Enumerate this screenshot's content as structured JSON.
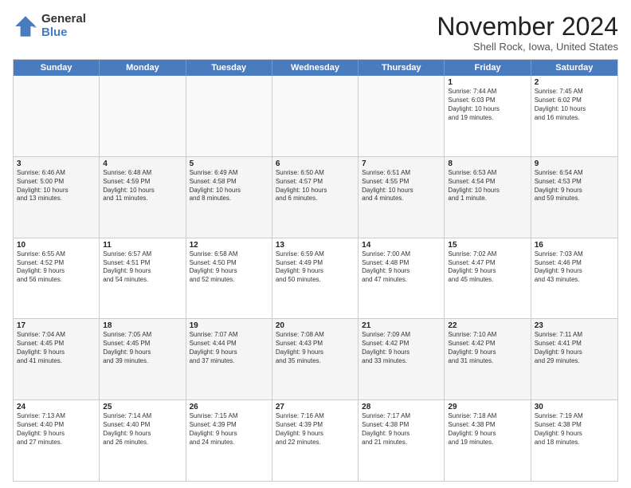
{
  "logo": {
    "general": "General",
    "blue": "Blue"
  },
  "header": {
    "month": "November 2024",
    "location": "Shell Rock, Iowa, United States"
  },
  "weekdays": [
    "Sunday",
    "Monday",
    "Tuesday",
    "Wednesday",
    "Thursday",
    "Friday",
    "Saturday"
  ],
  "rows": [
    [
      {
        "day": "",
        "text": ""
      },
      {
        "day": "",
        "text": ""
      },
      {
        "day": "",
        "text": ""
      },
      {
        "day": "",
        "text": ""
      },
      {
        "day": "",
        "text": ""
      },
      {
        "day": "1",
        "text": "Sunrise: 7:44 AM\nSunset: 6:03 PM\nDaylight: 10 hours\nand 19 minutes."
      },
      {
        "day": "2",
        "text": "Sunrise: 7:45 AM\nSunset: 6:02 PM\nDaylight: 10 hours\nand 16 minutes."
      }
    ],
    [
      {
        "day": "3",
        "text": "Sunrise: 6:46 AM\nSunset: 5:00 PM\nDaylight: 10 hours\nand 13 minutes."
      },
      {
        "day": "4",
        "text": "Sunrise: 6:48 AM\nSunset: 4:59 PM\nDaylight: 10 hours\nand 11 minutes."
      },
      {
        "day": "5",
        "text": "Sunrise: 6:49 AM\nSunset: 4:58 PM\nDaylight: 10 hours\nand 8 minutes."
      },
      {
        "day": "6",
        "text": "Sunrise: 6:50 AM\nSunset: 4:57 PM\nDaylight: 10 hours\nand 6 minutes."
      },
      {
        "day": "7",
        "text": "Sunrise: 6:51 AM\nSunset: 4:55 PM\nDaylight: 10 hours\nand 4 minutes."
      },
      {
        "day": "8",
        "text": "Sunrise: 6:53 AM\nSunset: 4:54 PM\nDaylight: 10 hours\nand 1 minute."
      },
      {
        "day": "9",
        "text": "Sunrise: 6:54 AM\nSunset: 4:53 PM\nDaylight: 9 hours\nand 59 minutes."
      }
    ],
    [
      {
        "day": "10",
        "text": "Sunrise: 6:55 AM\nSunset: 4:52 PM\nDaylight: 9 hours\nand 56 minutes."
      },
      {
        "day": "11",
        "text": "Sunrise: 6:57 AM\nSunset: 4:51 PM\nDaylight: 9 hours\nand 54 minutes."
      },
      {
        "day": "12",
        "text": "Sunrise: 6:58 AM\nSunset: 4:50 PM\nDaylight: 9 hours\nand 52 minutes."
      },
      {
        "day": "13",
        "text": "Sunrise: 6:59 AM\nSunset: 4:49 PM\nDaylight: 9 hours\nand 50 minutes."
      },
      {
        "day": "14",
        "text": "Sunrise: 7:00 AM\nSunset: 4:48 PM\nDaylight: 9 hours\nand 47 minutes."
      },
      {
        "day": "15",
        "text": "Sunrise: 7:02 AM\nSunset: 4:47 PM\nDaylight: 9 hours\nand 45 minutes."
      },
      {
        "day": "16",
        "text": "Sunrise: 7:03 AM\nSunset: 4:46 PM\nDaylight: 9 hours\nand 43 minutes."
      }
    ],
    [
      {
        "day": "17",
        "text": "Sunrise: 7:04 AM\nSunset: 4:45 PM\nDaylight: 9 hours\nand 41 minutes."
      },
      {
        "day": "18",
        "text": "Sunrise: 7:05 AM\nSunset: 4:45 PM\nDaylight: 9 hours\nand 39 minutes."
      },
      {
        "day": "19",
        "text": "Sunrise: 7:07 AM\nSunset: 4:44 PM\nDaylight: 9 hours\nand 37 minutes."
      },
      {
        "day": "20",
        "text": "Sunrise: 7:08 AM\nSunset: 4:43 PM\nDaylight: 9 hours\nand 35 minutes."
      },
      {
        "day": "21",
        "text": "Sunrise: 7:09 AM\nSunset: 4:42 PM\nDaylight: 9 hours\nand 33 minutes."
      },
      {
        "day": "22",
        "text": "Sunrise: 7:10 AM\nSunset: 4:42 PM\nDaylight: 9 hours\nand 31 minutes."
      },
      {
        "day": "23",
        "text": "Sunrise: 7:11 AM\nSunset: 4:41 PM\nDaylight: 9 hours\nand 29 minutes."
      }
    ],
    [
      {
        "day": "24",
        "text": "Sunrise: 7:13 AM\nSunset: 4:40 PM\nDaylight: 9 hours\nand 27 minutes."
      },
      {
        "day": "25",
        "text": "Sunrise: 7:14 AM\nSunset: 4:40 PM\nDaylight: 9 hours\nand 26 minutes."
      },
      {
        "day": "26",
        "text": "Sunrise: 7:15 AM\nSunset: 4:39 PM\nDaylight: 9 hours\nand 24 minutes."
      },
      {
        "day": "27",
        "text": "Sunrise: 7:16 AM\nSunset: 4:39 PM\nDaylight: 9 hours\nand 22 minutes."
      },
      {
        "day": "28",
        "text": "Sunrise: 7:17 AM\nSunset: 4:38 PM\nDaylight: 9 hours\nand 21 minutes."
      },
      {
        "day": "29",
        "text": "Sunrise: 7:18 AM\nSunset: 4:38 PM\nDaylight: 9 hours\nand 19 minutes."
      },
      {
        "day": "30",
        "text": "Sunrise: 7:19 AM\nSunset: 4:38 PM\nDaylight: 9 hours\nand 18 minutes."
      }
    ]
  ]
}
